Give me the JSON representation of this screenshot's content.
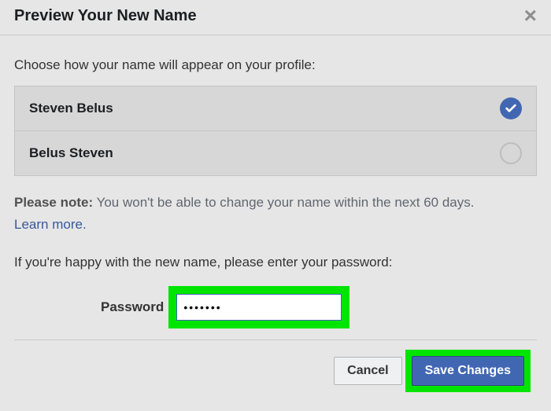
{
  "header": {
    "title": "Preview Your New Name"
  },
  "instruction": "Choose how your name will appear on your profile:",
  "name_options": [
    {
      "label": "Steven Belus",
      "selected": true
    },
    {
      "label": "Belus Steven",
      "selected": false
    }
  ],
  "note": {
    "label": "Please note:",
    "text": " You won't be able to change your name within the next 60 days.",
    "learn_more": "Learn more"
  },
  "password_section": {
    "prompt": "If you're happy with the new name, please enter your password:",
    "label": "Password",
    "value": "•••••••"
  },
  "footer": {
    "cancel": "Cancel",
    "save": "Save Changes"
  }
}
